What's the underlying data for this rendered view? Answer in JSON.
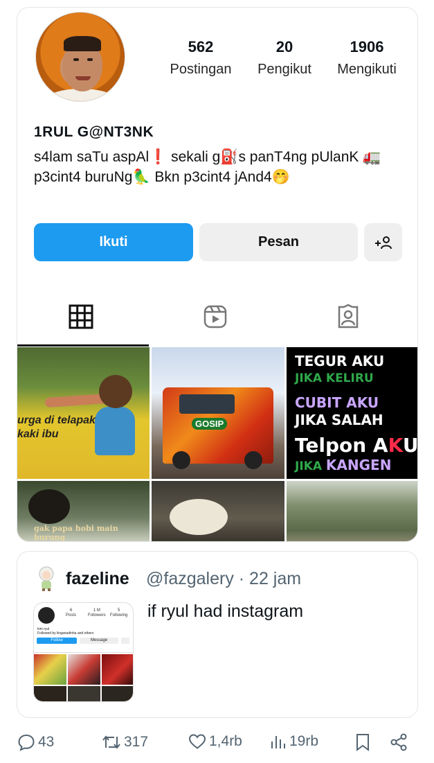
{
  "profile": {
    "display_name": "1RUL G@NT3NK",
    "bio": "s4lam saTu aspAl❗ sekali g⛽s panT4ng pUlanK 🚛 p3cint4 buruNg🦜 Bkn p3cint4 jAnd4🤭",
    "stats": [
      {
        "value": "562",
        "label": "Postingan"
      },
      {
        "value": "20",
        "label": "Pengikut"
      },
      {
        "value": "1906",
        "label": "Mengikuti"
      }
    ],
    "buttons": {
      "follow": "Ikuti",
      "message": "Pesan"
    },
    "accent_color": "#1d9bf0"
  },
  "grid_posts": [
    {
      "caption": "urga di telapak\nkaki ibu"
    },
    {
      "caption": "GOSIP"
    },
    {
      "lines": [
        "TEGUR AKU",
        "JIKA KELIRU",
        "CUBIT AKU",
        "JIKA SALAH",
        "Telpon A",
        "K",
        "U",
        "JIKA",
        "KANGEN"
      ]
    },
    {
      "caption": "gak papa hobi main burung"
    },
    {
      "caption": ""
    },
    {
      "caption": ""
    }
  ],
  "tweet": {
    "name": "fazeline",
    "handle": "@fazgalery",
    "time": "· 22 jam",
    "text": "if ryul had instagram",
    "thumb": {
      "stats": [
        [
          "6",
          "Posts"
        ],
        [
          "1 M",
          "Followers"
        ],
        [
          "5",
          "Following"
        ]
      ],
      "name": "kim ryul",
      "followed_by": "Followed by linganadinha and others",
      "follow": "Follow",
      "message": "Message"
    }
  },
  "actions": {
    "replies": "43",
    "reposts": "317",
    "likes": "1,4rb",
    "views": "19rb"
  }
}
